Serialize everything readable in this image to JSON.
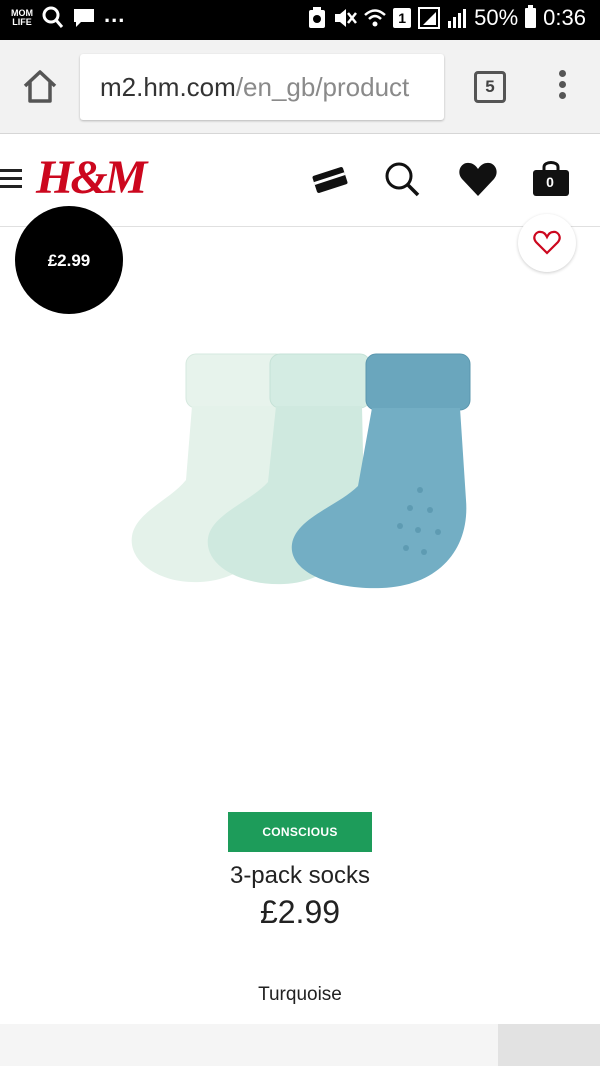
{
  "status_bar": {
    "app_label": "MOM LIFE",
    "more": "...",
    "sim": "1",
    "battery": "50%",
    "time": "0:36"
  },
  "browser": {
    "url_host": "m2.hm.com",
    "url_path": "/en_gb/product",
    "tab_count": "5"
  },
  "header": {
    "logo": "H&M",
    "bag_count": "0"
  },
  "product": {
    "price_badge": "£2.99",
    "tag": "CONSCIOUS",
    "name": "3-pack socks",
    "price": "£2.99",
    "color": "Turquoise"
  },
  "colors": {
    "brand_red": "#cc071e",
    "conscious_green": "#1d9c5a",
    "sock_blue": "#6aa6bd",
    "sock_mint": "#d4ece3",
    "sock_pale": "#e4f2ea"
  }
}
